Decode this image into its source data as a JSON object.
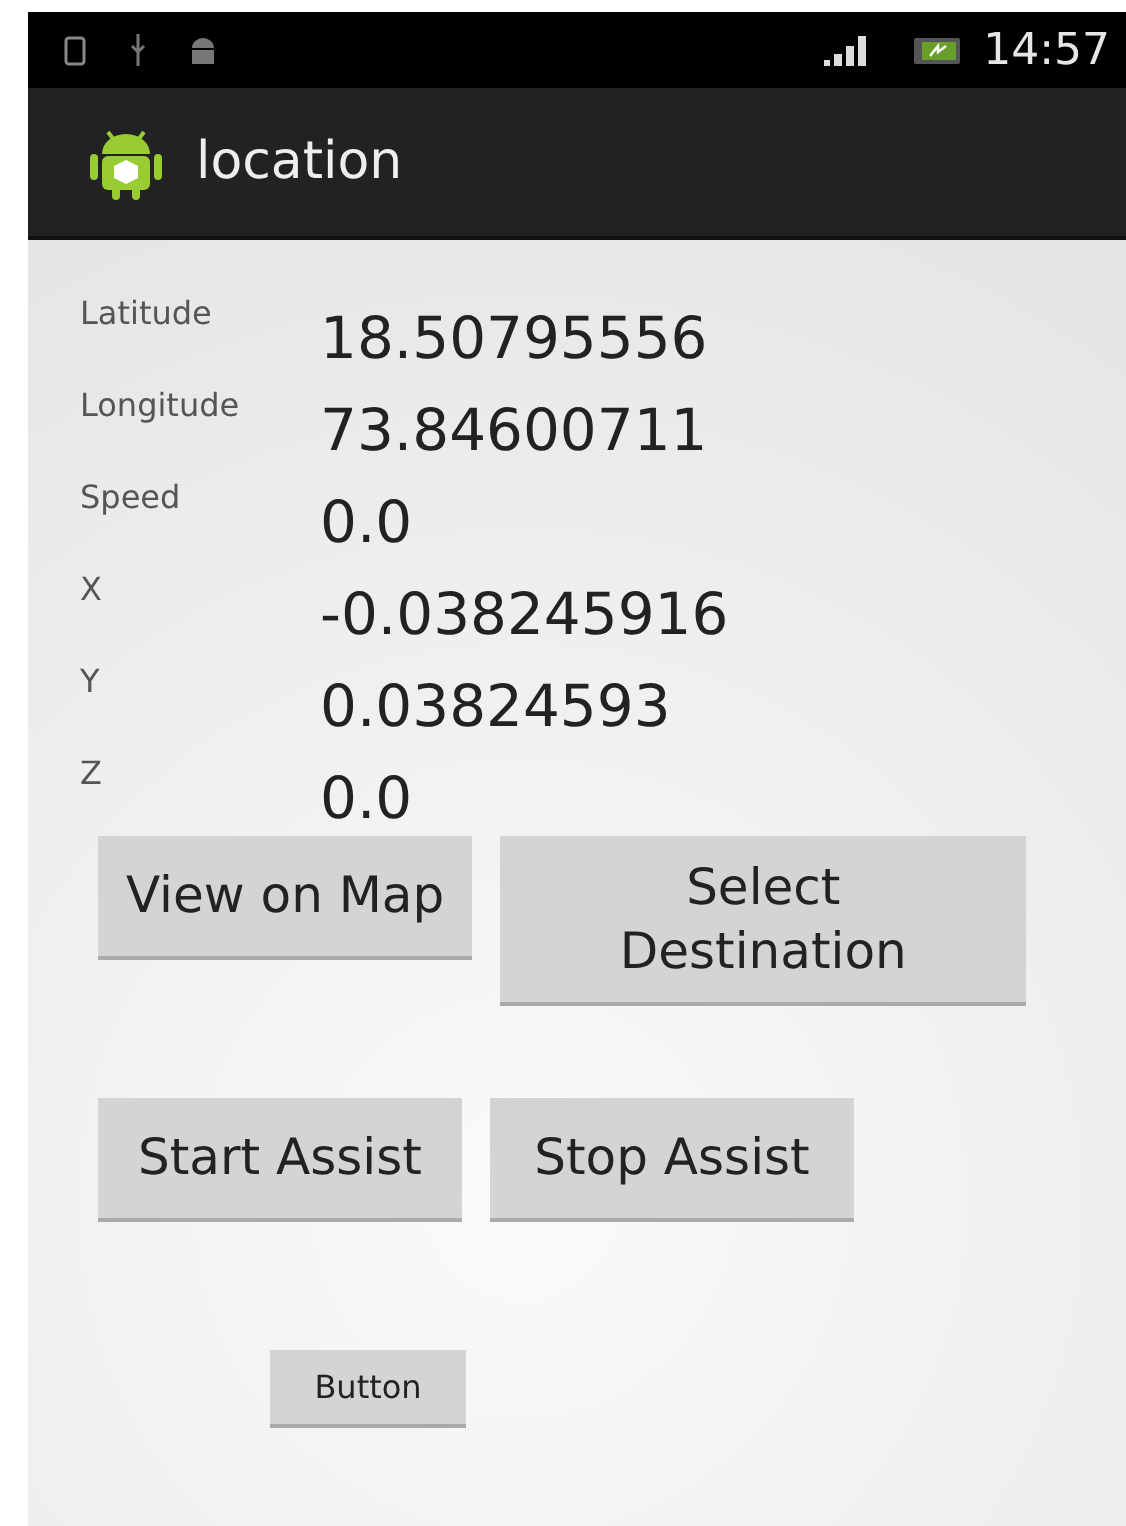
{
  "status_bar": {
    "time": "14:57"
  },
  "action_bar": {
    "title": "location"
  },
  "readings": [
    {
      "label": "Latitude",
      "value": "18.50795556"
    },
    {
      "label": "Longitude",
      "value": "73.84600711"
    },
    {
      "label": "Speed",
      "value": "0.0"
    },
    {
      "label": "X",
      "value": "-0.038245916"
    },
    {
      "label": "Y",
      "value": "0.03824593"
    },
    {
      "label": "Z",
      "value": "0.0"
    }
  ],
  "button_rows": [
    [
      "View on Map",
      "Select Destination"
    ],
    [
      "Start Assist",
      "Stop Assist"
    ]
  ],
  "small_button": "Button"
}
